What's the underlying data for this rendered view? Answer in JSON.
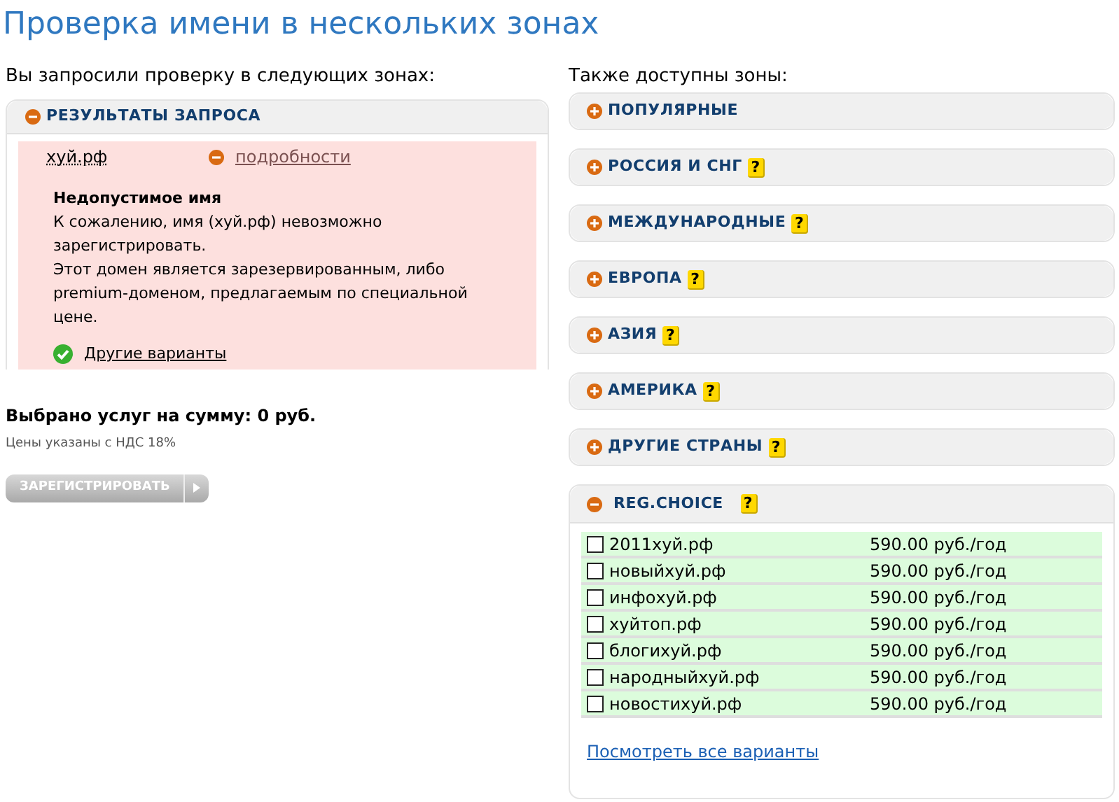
{
  "title": "Проверка имени в нескольких зонах",
  "left": {
    "heading": "Вы запросили проверку в следующих зонах:",
    "results": {
      "label": "РЕЗУЛЬТАТЫ ЗАПРОСА",
      "expanded": true,
      "domain": "хуй.рф",
      "details_link": "подробности",
      "error_title": "Недопустимое имя",
      "error_lines": [
        "К сожалению, имя (хуй.рф) невозможно зарегистрировать.",
        "Этот домен является зарезервированным, либо premium-доменом, предлагаемым по специальной цене."
      ],
      "alternatives_link": "Другие варианты"
    },
    "total": "Выбрано услуг на сумму: 0 руб.",
    "vat_note": "Цены указаны с НДС 18%",
    "register_button": "ЗАРЕГИСТРИРОВАТЬ"
  },
  "right": {
    "heading": "Также доступны зоны:",
    "zones": [
      {
        "label": "ПОПУЛЯРНЫЕ",
        "expanded": false
      },
      {
        "label": "РОССИЯ И СНГ",
        "expanded": false,
        "help_icon": "?"
      },
      {
        "label": "МЕЖДУНАРОДНЫЕ",
        "expanded": false,
        "help_icon": "?"
      },
      {
        "label": "ЕВРОПА",
        "expanded": false,
        "help_icon": "?"
      },
      {
        "label": "АЗИЯ",
        "expanded": false,
        "help_icon": "?"
      },
      {
        "label": "АМЕРИКА",
        "expanded": false,
        "help_icon": "?"
      },
      {
        "label": "ДРУГИЕ СТРАНЫ",
        "expanded": false,
        "help_icon": "?"
      },
      {
        "label": "REG.CHOICE",
        "expanded": true,
        "help_icon": "?",
        "domains": [
          {
            "name": "2011хуй.рф",
            "price": "590.00 руб./год",
            "checked": false
          },
          {
            "name": "новыйхуй.рф",
            "price": "590.00 руб./год",
            "checked": false
          },
          {
            "name": "инфохуй.рф",
            "price": "590.00 руб./год",
            "checked": false
          },
          {
            "name": "хуйтоп.рф",
            "price": "590.00 руб./год",
            "checked": false
          },
          {
            "name": "блогихуй.рф",
            "price": "590.00 руб./год",
            "checked": false
          },
          {
            "name": "народныйхуй.рф",
            "price": "590.00 руб./год",
            "checked": false
          },
          {
            "name": "новостихуй.рф",
            "price": "590.00 руб./год",
            "checked": false
          }
        ],
        "more_link": "Посмотреть все варианты"
      }
    ]
  }
}
